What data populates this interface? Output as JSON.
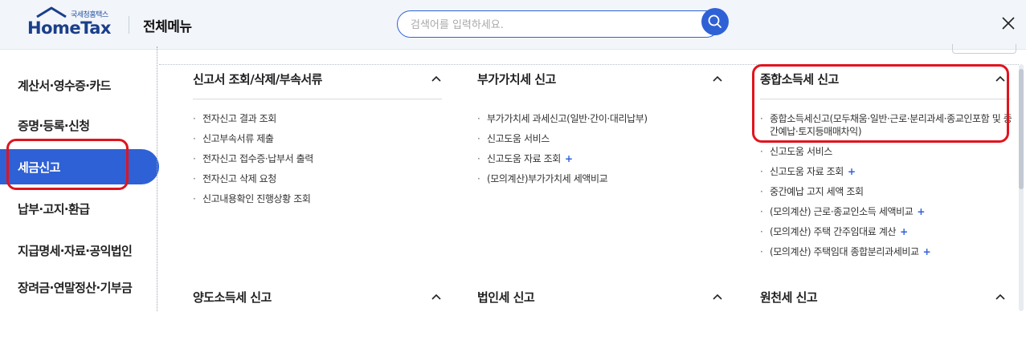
{
  "header": {
    "logo_small": "국세청홈택스",
    "logo_big": "HomeTax",
    "menu_title": "전체메뉴",
    "search_placeholder": "검색어를 입력하세요."
  },
  "sidebar": {
    "items": [
      {
        "label": "계산서·영수증·카드"
      },
      {
        "label": "증명·등록·신청"
      },
      {
        "label": "세금신고",
        "active": true
      },
      {
        "label": "납부·고지·환급"
      },
      {
        "label": "지급명세·자료·공익법인"
      },
      {
        "label": "장려금·연말정산·기부금"
      }
    ]
  },
  "columns": [
    {
      "title": "신고서 조회/삭제/부속서류",
      "links": [
        {
          "label": "전자신고 결과 조회"
        },
        {
          "label": "신고부속서류 제출"
        },
        {
          "label": "전자신고 접수증·납부서 출력"
        },
        {
          "label": "전자신고 삭제 요청"
        },
        {
          "label": "신고내용확인 진행상황 조회"
        }
      ]
    },
    {
      "title": "부가가치세 신고",
      "links": [
        {
          "label": "부가가치세 과세신고(일반·간이·대리납부)"
        },
        {
          "label": "신고도움 서비스"
        },
        {
          "label": "신고도움 자료 조회",
          "plus": "+"
        },
        {
          "label": "(모의계산)부가가치세 세액비교"
        }
      ]
    },
    {
      "title": "종합소득세 신고",
      "links": [
        {
          "label": "종합소득세신고(모두채움·일반·근로·분리과세·종교인포함 및 중간예납·토지등매매차익)"
        },
        {
          "label": "신고도움 서비스"
        },
        {
          "label": "신고도움 자료 조회",
          "plus": "+"
        },
        {
          "label": "중간예납 고지 세액 조회"
        },
        {
          "label": "(모의계산) 근로·종교인소득 세액비교",
          "plus": "+"
        },
        {
          "label": "(모의계산) 주택 간주임대료 계산",
          "plus": "+"
        },
        {
          "label": "(모의계산) 주택임대 종합분리과세비교",
          "plus": "+"
        }
      ]
    }
  ],
  "bottom_sections": [
    {
      "title": "양도소득세 신고"
    },
    {
      "title": "법인세 신고"
    },
    {
      "title": "원천세 신고"
    }
  ],
  "colors": {
    "accent": "#2f61d6",
    "highlight": "#e0141e",
    "logo": "#1a3f8a"
  }
}
